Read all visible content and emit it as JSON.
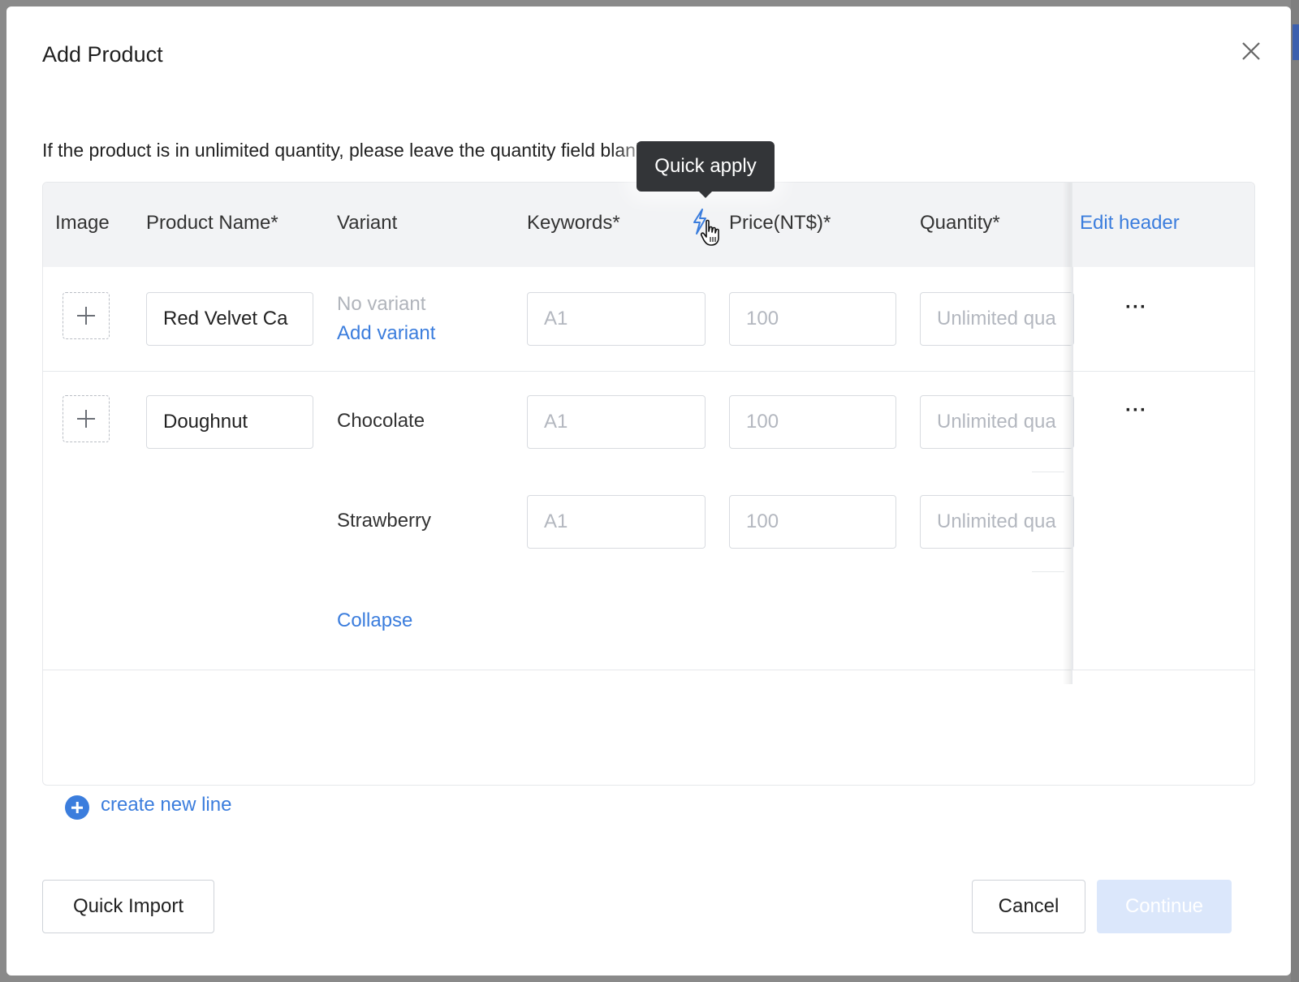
{
  "dialog": {
    "title": "Add Product",
    "hint": "If the product is in unlimited quantity, please leave the quantity field blank"
  },
  "table": {
    "headers": {
      "image": "Image",
      "product_name": "Product Name*",
      "variant": "Variant",
      "keywords": "Keywords*",
      "price": "Price(NT$)*",
      "quantity": "Quantity*",
      "edit_header": "Edit header"
    },
    "tooltip": "Quick apply",
    "products": [
      {
        "name": "Red Velvet Ca",
        "no_variant": "No variant",
        "add_variant": "Add variant",
        "keywords_placeholder": "A1",
        "price_placeholder": "100",
        "quantity_placeholder": "Unlimited quantity"
      },
      {
        "name": "Doughnut",
        "variants": [
          {
            "name": "Chocolate",
            "keywords_placeholder": "A1",
            "price_placeholder": "100",
            "quantity_placeholder": "Unlimited quantity"
          },
          {
            "name": "Strawberry",
            "keywords_placeholder": "A1",
            "price_placeholder": "100",
            "quantity_placeholder": "Unlimited quantity"
          }
        ],
        "collapse": "Collapse"
      }
    ],
    "more_actions": "···"
  },
  "create_new_line": "create new line",
  "footer": {
    "quick_import": "Quick Import",
    "cancel": "Cancel",
    "continue": "Continue"
  },
  "colors": {
    "accent": "#3b7ddd",
    "header_bg": "#f2f3f5",
    "tooltip_bg": "#333538",
    "disabled_primary": "#dbe7fb"
  }
}
